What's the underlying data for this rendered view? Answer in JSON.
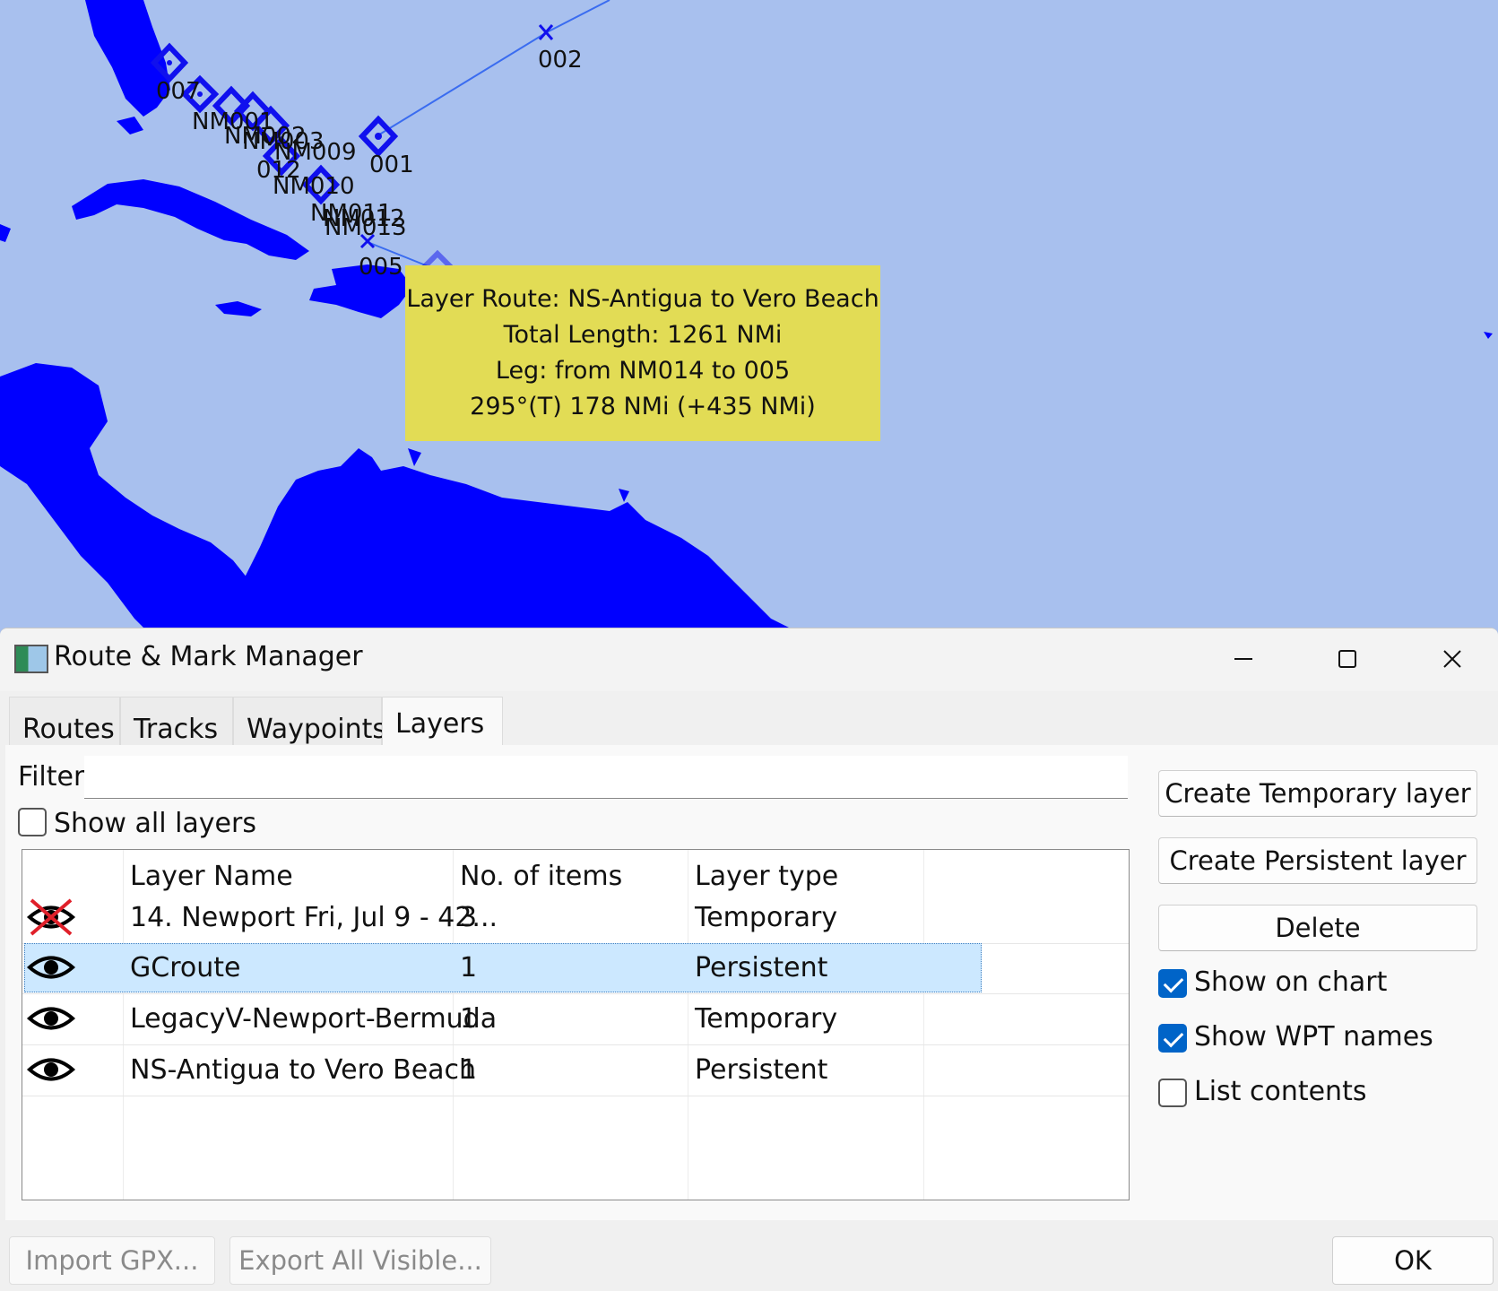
{
  "chart": {
    "waypoint_labels": [
      "002",
      "007",
      "NM001",
      "NM002",
      "NM003",
      "NM009",
      "001",
      "012",
      "NM010",
      "NM011",
      "NM012",
      "NM013",
      "005"
    ],
    "colors": {
      "sea": "#a8c0ee",
      "land": "#0000ff",
      "route": "#3a6cf0",
      "tooltip_bg": "#e2dc55"
    }
  },
  "tooltip": {
    "line1": "Layer Route: NS-Antigua to Vero Beach",
    "line2": "Total Length: 1261 NMi",
    "line3": "Leg: from NM014 to 005",
    "line4": "295°(T) 178 NMi (+435 NMi)"
  },
  "dialog": {
    "title": "Route & Mark Manager",
    "controls": {
      "minimize": "—",
      "maximize": "☐",
      "close": "✕"
    },
    "tabs": [
      "Routes",
      "Tracks",
      "Waypoints",
      "Layers"
    ],
    "active_tab": "Layers",
    "filter_label": "Filter",
    "filter_value": "",
    "show_all_layers": {
      "label": "Show all layers",
      "checked": false
    },
    "table": {
      "columns": [
        "",
        "Layer Name",
        "No. of items",
        "Layer type"
      ],
      "rows": [
        {
          "visible": false,
          "name": "14. Newport Fri, Jul 9  - 42...",
          "items": "3",
          "type": "Temporary"
        },
        {
          "visible": true,
          "name": "GCroute",
          "items": "1",
          "type": "Persistent",
          "selected": true
        },
        {
          "visible": true,
          "name": "LegacyV-Newport-Bermuda",
          "items": "1",
          "type": "Temporary"
        },
        {
          "visible": true,
          "name": "NS-Antigua to Vero Beach",
          "items": "1",
          "type": "Persistent"
        }
      ]
    },
    "buttons": {
      "create_temporary": "Create Temporary layer",
      "create_persistent": "Create Persistent layer",
      "delete": "Delete"
    },
    "options": {
      "show_on_chart": {
        "label": "Show on chart",
        "checked": true
      },
      "show_wpt_names": {
        "label": "Show WPT names",
        "checked": true
      },
      "list_contents": {
        "label": "List contents",
        "checked": false
      }
    },
    "footer": {
      "import": "Import GPX...",
      "export": "Export All Visible...",
      "ok": "OK"
    }
  }
}
